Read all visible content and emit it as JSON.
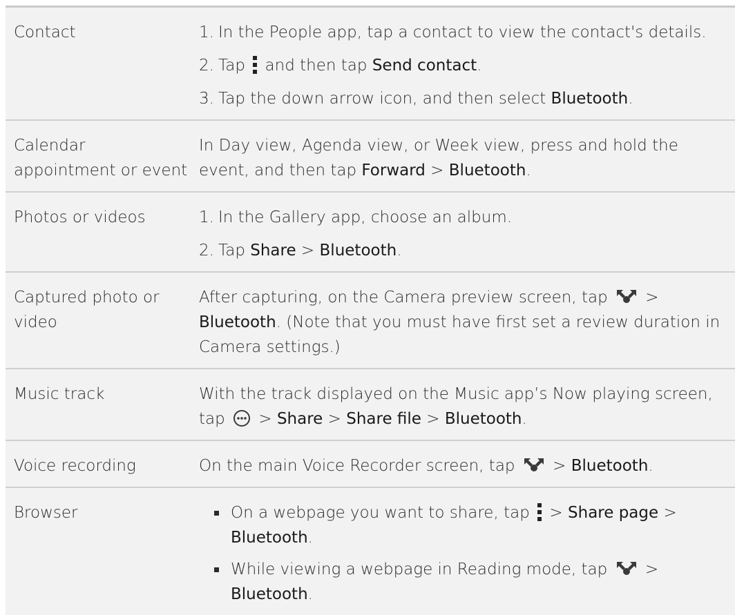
{
  "rows": [
    {
      "label": "Contact",
      "steps": [
        {
          "num": "1.",
          "parts": [
            "In the People app, tap a contact to view the contact's details."
          ]
        },
        {
          "num": "2.",
          "a": "Tap ",
          "b": " and then tap ",
          "ui": "Send contact",
          "c": "."
        },
        {
          "num": "3.",
          "a": "Tap the down arrow icon, and then select ",
          "ui": "Bluetooth",
          "c": "."
        }
      ]
    },
    {
      "label": "Calendar appointment or event",
      "a": "In Day view, Agenda view, or Week view, press and hold the event, and then tap ",
      "ui1": "Forward",
      "sep": " > ",
      "ui2": "Bluetooth",
      "c": "."
    },
    {
      "label": "Photos or videos",
      "steps": [
        {
          "num": "1.",
          "text": "In the Gallery app, choose an album."
        },
        {
          "num": "2.",
          "a": "Tap ",
          "ui1": "Share",
          "sep": " > ",
          "ui2": "Bluetooth",
          "c": "."
        }
      ]
    },
    {
      "label": "Captured photo or video",
      "a": "After capturing, on the Camera preview screen, tap ",
      "sep": " > ",
      "ui": "Bluetooth",
      "c": ". (Note that you must have first set a review duration in Camera settings.)"
    },
    {
      "label": "Music track",
      "a": "With the track displayed on the Music app’s Now playing screen, tap ",
      "sep1": " > ",
      "ui1": "Share",
      "sep2": " > ",
      "ui2": "Share file",
      "sep3": " > ",
      "ui3": "Bluetooth",
      "c": "."
    },
    {
      "label": "Voice recording",
      "a": "On the main Voice Recorder screen, tap ",
      "sep": " > ",
      "ui": "Bluetooth",
      "c": "."
    },
    {
      "label": "Browser",
      "bullets": [
        {
          "a": "On a webpage you want to share, tap ",
          "sep": " > ",
          "ui1": "Share page",
          "sep2": " > ",
          "ui2": "Bluetooth",
          "c": "."
        },
        {
          "a": "While viewing a webpage in Reading mode, tap ",
          "sep": " > ",
          "ui": "Bluetooth",
          "c": "."
        }
      ]
    }
  ],
  "icons": {
    "menu": "menu-icon",
    "share": "share-icon",
    "more": "more-icon"
  }
}
